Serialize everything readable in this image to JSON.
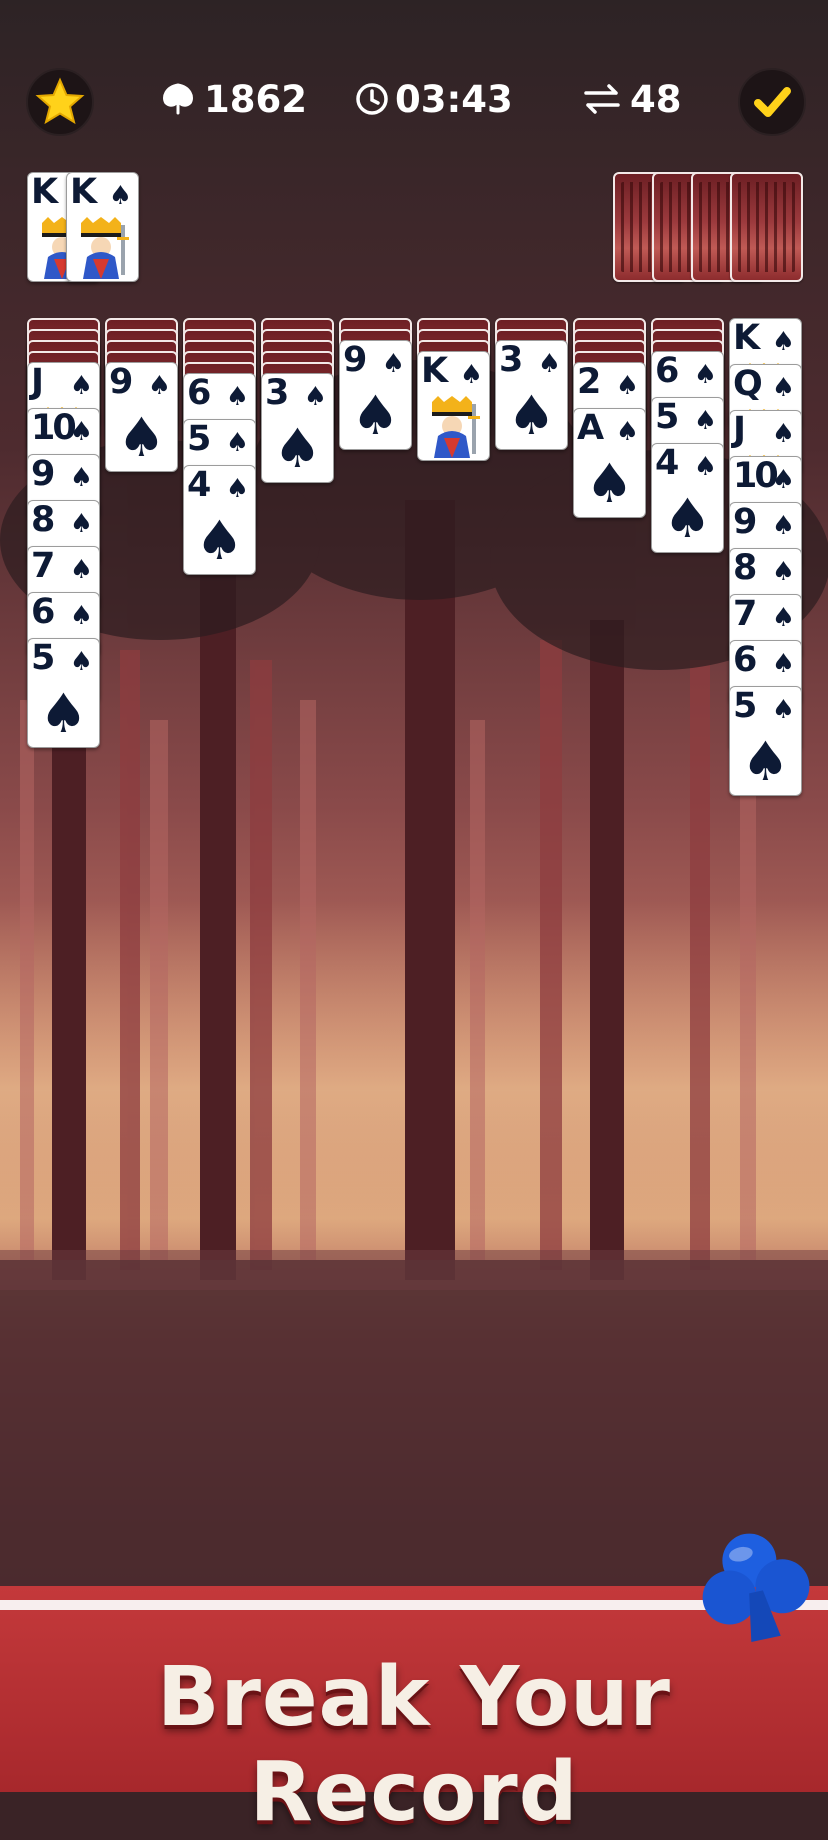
{
  "hud": {
    "score": "1862",
    "time": "03:43",
    "moves": "48",
    "star_icon": "star-icon",
    "leaf_icon": "leaf-icon",
    "clock_icon": "clock-icon",
    "moves_icon": "swap-arrows-icon",
    "check_icon": "checkmark-icon"
  },
  "completed_suits": [
    {
      "rank": "K",
      "suit": "♠"
    },
    {
      "rank": "K",
      "suit": "♠"
    }
  ],
  "stock": {
    "piles": 4
  },
  "tableau": [
    {
      "hidden": 4,
      "faceup": [
        "J",
        "10",
        "9",
        "8",
        "7",
        "6",
        "5"
      ]
    },
    {
      "hidden": 4,
      "faceup": [
        "9"
      ]
    },
    {
      "hidden": 5,
      "faceup": [
        "6",
        "5",
        "4"
      ]
    },
    {
      "hidden": 5,
      "faceup": [
        "3"
      ]
    },
    {
      "hidden": 2,
      "faceup": [
        "9"
      ]
    },
    {
      "hidden": 3,
      "faceup": [
        "K"
      ]
    },
    {
      "hidden": 2,
      "faceup": [
        "3"
      ]
    },
    {
      "hidden": 4,
      "faceup": [
        "2",
        "A"
      ]
    },
    {
      "hidden": 3,
      "faceup": [
        "6",
        "5",
        "4"
      ]
    },
    {
      "hidden": 0,
      "faceup": [
        "K",
        "Q",
        "J",
        "10",
        "9",
        "8",
        "7",
        "6",
        "5"
      ]
    }
  ],
  "suit_symbol": "♠",
  "banner": {
    "title": "Break Your Record",
    "logo_icon": "club-logo-icon"
  },
  "colors": {
    "card_ink": "#0d1a35",
    "banner_red": "#b52f32",
    "star_yellow": "#ffd21a",
    "check_yellow": "#ffd21a"
  }
}
